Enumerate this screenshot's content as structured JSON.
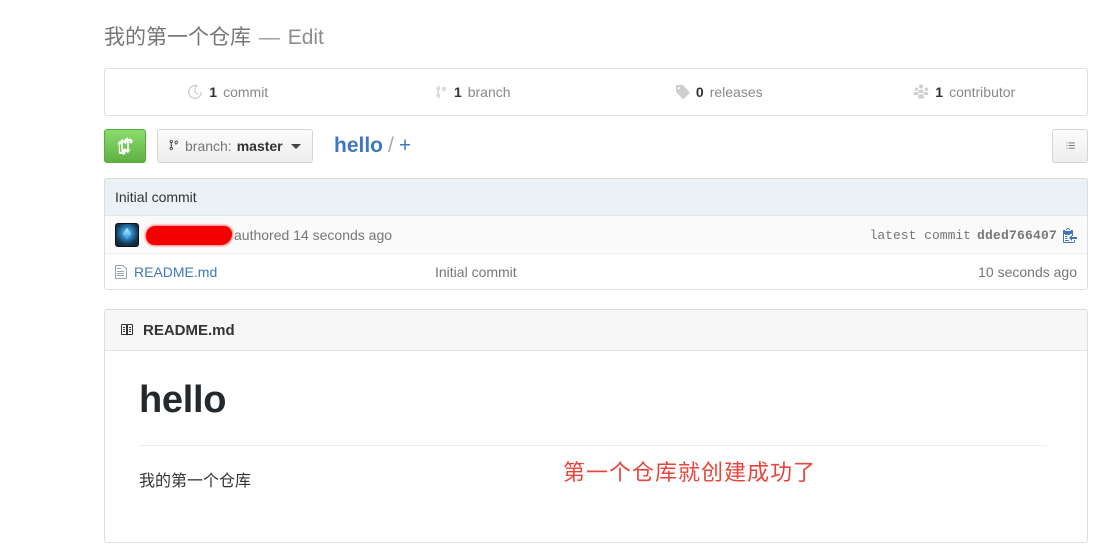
{
  "repo": {
    "name": "我的第一个仓库",
    "separator": "—",
    "edit_label": "Edit"
  },
  "numbers_bar": [
    {
      "icon": "history-icon",
      "count": "1",
      "label": "commit"
    },
    {
      "icon": "branch-icon",
      "count": "1",
      "label": "branch"
    },
    {
      "icon": "tag-icon",
      "count": "0",
      "label": "releases"
    },
    {
      "icon": "organization-icon",
      "count": "1",
      "label": "contributor"
    }
  ],
  "toolbar": {
    "compare_button_icon": "git-compare-icon",
    "branch_prefix": "branch:",
    "branch_name": "master",
    "breadcrumb_repo": "hello",
    "breadcrumb_slash": "/",
    "breadcrumb_add": "+",
    "history_button_icon": "list-unordered-icon"
  },
  "commit": {
    "message": "Initial commit",
    "author_redacted": true,
    "authored_text": "authored 14 seconds ago",
    "latest_commit_label": "latest commit",
    "sha": "dded766407",
    "copy_icon": "clippy-icon"
  },
  "files": {
    "rows": [
      {
        "icon": "file-text-icon",
        "name": "README.md",
        "message": "Initial commit",
        "age": "10 seconds ago"
      }
    ]
  },
  "readme": {
    "header_icon": "book-icon",
    "header_title": "README.md",
    "heading": "hello",
    "paragraph": "我的第一个仓库",
    "annotation": "第一个仓库就创建成功了"
  },
  "colors": {
    "link": "#4078c0",
    "green_button": "#60b044",
    "annotation_red": "#e8453c",
    "commit_header_bg": "#eaf2f5",
    "redaction_red": "#f40000"
  }
}
